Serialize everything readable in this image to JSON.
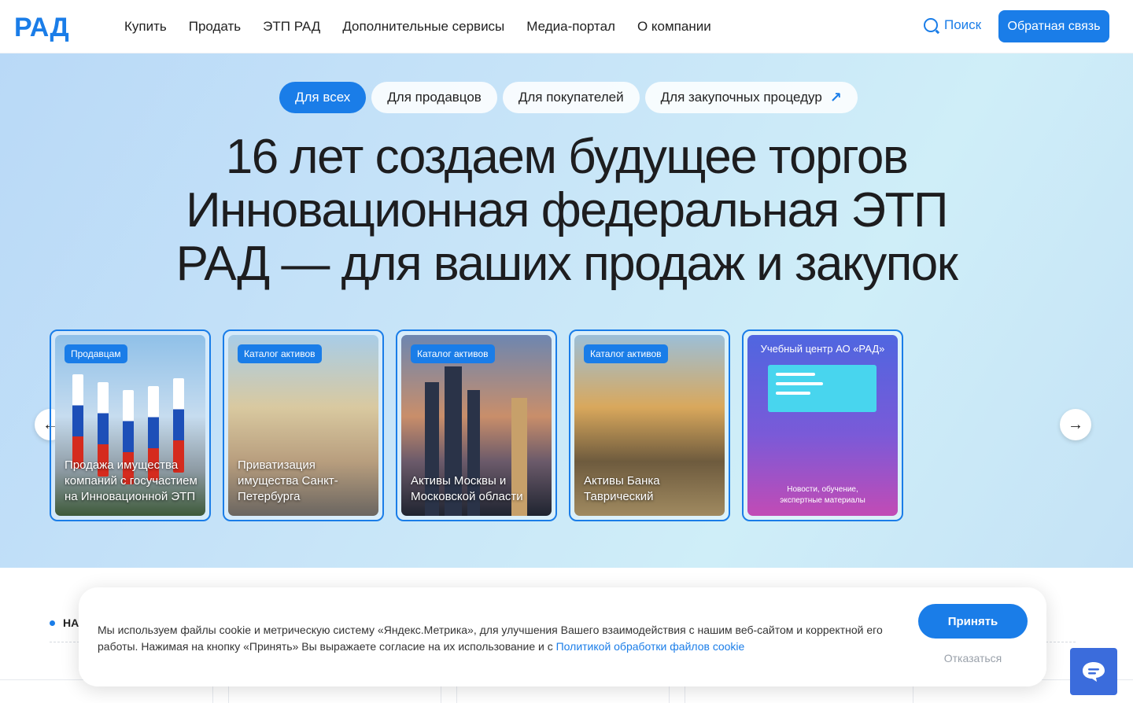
{
  "header": {
    "logo_text": "РАД",
    "nav": [
      "Купить",
      "Продать",
      "ЭТП РАД",
      "Дополнительные сервисы",
      "Медиа-портал",
      "О компании"
    ],
    "search_label": "Поиск",
    "feedback_label": "Обратная связь"
  },
  "hero": {
    "segments": [
      "Для всех",
      "Для продавцов",
      "Для покупателей",
      "Для закупочных процедур"
    ],
    "title_lines": [
      "16 лет создаем будущее торгов",
      "Инновационная федеральная ЭТП",
      "РАД — для ваших продаж и закупок"
    ],
    "cards": [
      {
        "badge": "Продавцам",
        "text": "Продажа имущества компаний с госучастием на Инновационной ЭТП"
      },
      {
        "badge": "Каталог активов",
        "text": "Приватизация имущества Санкт-Петербурга"
      },
      {
        "badge": "Каталог активов",
        "text": "Активы Москвы и Московской области"
      },
      {
        "badge": "Каталог активов",
        "text": "Активы Банка Таврический"
      },
      {
        "title": "Учебный центр АО «РАД»",
        "subtitle_1": "Новости, обучение,",
        "subtitle_2": "экспертные материалы"
      }
    ]
  },
  "section": {
    "label": "НА"
  },
  "cookie": {
    "text": "Мы используем файлы cookie и метрическую систему «Яндекс.Метрика», для улучшения Вашего взаимодействия с нашим веб-сайтом и корректной его работы. Нажимая на кнопку «Принять» Вы выражаете согласие на их использование и с ",
    "link": "Политикой обработки файлов cookie",
    "accept": "Принять",
    "decline": "Отказаться"
  },
  "colors": {
    "accent": "#1a7de8",
    "chat": "#3b6cdc"
  }
}
